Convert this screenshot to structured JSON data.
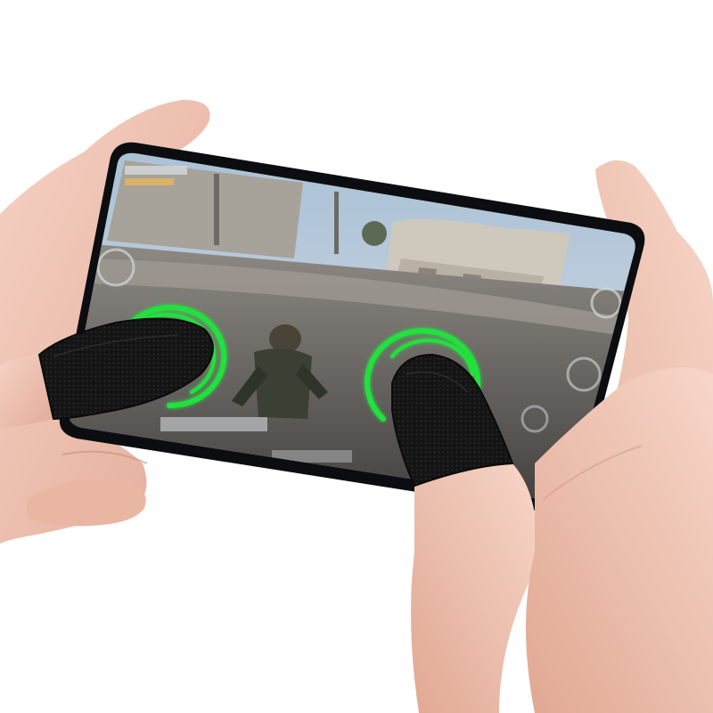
{
  "scene": {
    "subject": "hands-holding-phone-with-finger-sleeves",
    "background_color": "#ffffff",
    "skin_color": "#f2c6b6",
    "skin_shadow_color": "#d89c88",
    "phone_body_color": "#0c0d10",
    "sleeve_color": "#151515",
    "ring_color": "#22e03c",
    "ring_glow_color": "#7dff8a"
  },
  "game_screen": {
    "sky_color": "#b9cde0",
    "building_color": "#c9c3b8",
    "ground_color": "#5d5a57",
    "road_color": "#8c8781",
    "character_color": "#3a4034",
    "hud_color": "#d6d9dc"
  },
  "icons": {
    "left_ring": "touch-ring-icon",
    "right_ring": "touch-ring-icon"
  }
}
